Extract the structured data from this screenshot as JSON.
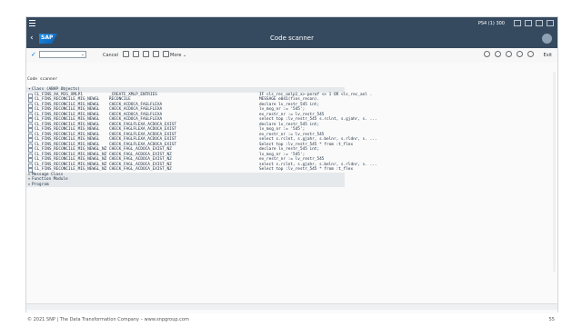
{
  "system": {
    "info": "PS4 (1) 300"
  },
  "shell": {
    "logo": "SAP",
    "title": "Code scanner"
  },
  "toolbar": {
    "cancel": "Cancel",
    "more": "More",
    "exit": "Exit"
  },
  "breadcrumb": "Code scanner",
  "tree": {
    "class_node": "Class (ABAP Objects)",
    "rows": [
      {
        "name": "CL_FINS_AA_MIG_XMLP1",
        "method": "_CREATE_XMLP_ENTRIES",
        "code": "IF <ls_rec_anlp1_x>-peraf <> 1 OR <ls_rec_anl ."
      },
      {
        "name": "CL_FINS_RECONCILE_MIG_NEWGL",
        "method": "RECONCILE",
        "code": "MESSAGE e041(fins_recon)."
      },
      {
        "name": "CL_FINS_RECONCILE_MIG_NEWGL",
        "method": "CHECK_ACDOCA_FAGLFLEXA",
        "code": "declare lv_restr_545 int;"
      },
      {
        "name": "CL_FINS_RECONCILE_MIG_NEWGL",
        "method": "CHECK_ACDOCA_FAGLFLEXA",
        "code": "lv_msg_nr := '545';"
      },
      {
        "name": "CL_FINS_RECONCILE_MIG_NEWGL",
        "method": "CHECK_ACDOCA_FAGLFLEXA",
        "code": "ev_restr_nr := lv_restr_545"
      },
      {
        "name": "CL_FINS_RECONCILE_MIG_NEWGL",
        "method": "CHECK_ACDOCA_FAGLFLEXA",
        "code": "select top :lv_restr_545 s.rclnt, s.gjahr, s. ..."
      },
      {
        "name": "CL_FINS_RECONCILE_MIG_NEWGL",
        "method": "CHECK_FAGLFLEXA_ACDOCA_EXIST",
        "code": "declare lv_restr_545 int;"
      },
      {
        "name": "CL_FINS_RECONCILE_MIG_NEWGL",
        "method": "CHECK_FAGLFLEXA_ACDOCA_EXIST",
        "code": "lv_msg_nr := '545';"
      },
      {
        "name": "CL_FINS_RECONCILE_MIG_NEWGL",
        "method": "CHECK_FAGLFLEXA_ACDOCA_EXIST",
        "code": "ev_restr_nr := lv_restr_545"
      },
      {
        "name": "CL_FINS_RECONCILE_MIG_NEWGL",
        "method": "CHECK_FAGLFLEXA_ACDOCA_EXIST",
        "code": "select s.rclnt, s.gjahr, s.belnr, s.rldnr, s. ..."
      },
      {
        "name": "CL_FINS_RECONCILE_MIG_NEWGL",
        "method": "CHECK_FAGLFLEXA_ACDOCA_EXIST",
        "code": "Select top :lv_restr_545 * from :t_flex"
      },
      {
        "name": "CL_FINS_RECONCILE_MIG_NEWGL_NZ",
        "method": "CHECK_FAGL_ACDOCA_EXIST_NZ",
        "code": "declare lv_restr_545 int;"
      },
      {
        "name": "CL_FINS_RECONCILE_MIG_NEWGL_NZ",
        "method": "CHECK_FAGL_ACDOCA_EXIST_NZ",
        "code": "lv_msg_nr := '545';"
      },
      {
        "name": "CL_FINS_RECONCILE_MIG_NEWGL_NZ",
        "method": "CHECK_FAGL_ACDOCA_EXIST_NZ",
        "code": "ev_restr_nr := lv_restr_545"
      },
      {
        "name": "CL_FINS_RECONCILE_MIG_NEWGL_NZ",
        "method": "CHECK_FAGL_ACDOCA_EXIST_NZ",
        "code": "select s.rclnt, s.gjahr, s.belnr, s.rldnr, s. ..."
      },
      {
        "name": "CL_FINS_RECONCILE_MIG_NEWGL_NZ",
        "method": "CHECK_FAGL_ACDOCA_EXIST_NZ",
        "code": "Select top :lv_restr_545 * from :t_flex"
      }
    ],
    "other_nodes": [
      "Message Class",
      "Function Module",
      "Program"
    ]
  },
  "footer": {
    "copyright": "© 2021 SNP | The Data Transformation Company – www.snpgroup.com",
    "page": "55"
  }
}
